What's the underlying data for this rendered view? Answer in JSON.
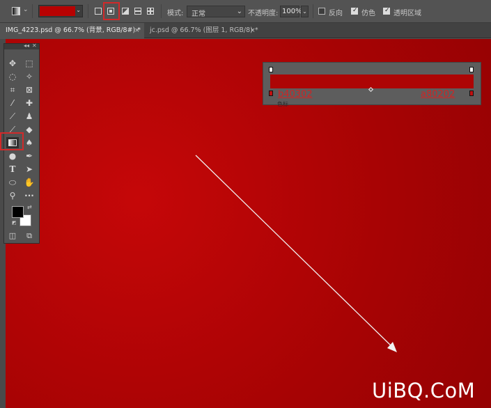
{
  "options_bar": {
    "gradient_color": "#b80202",
    "mode_label": "模式:",
    "mode_value": "正常",
    "opacity_label": "不透明度:",
    "opacity_value": "100%",
    "reverse_label": "反向",
    "dither_label": "仿色",
    "transparency_label": "透明区域",
    "reverse_checked": false,
    "dither_checked": true,
    "transparency_checked": true,
    "gradient_types": [
      "linear-gradient-icon",
      "radial-gradient-icon",
      "angle-gradient-icon",
      "reflected-gradient-icon",
      "diamond-gradient-icon"
    ],
    "selected_gradient_type": "radial-gradient-icon"
  },
  "tabs": [
    {
      "label": "IMG_4223.psd @ 66.7% (背景, RGB/8#) *",
      "close": "×",
      "active": true
    },
    {
      "label": "jc.psd @ 66.7% (图层 1, RGB/8) *",
      "close": "×",
      "active": false
    }
  ],
  "tools_panel": {
    "header_left": "◂◂",
    "header_right": "✕",
    "tools": [
      "move-icon",
      "marquee-icon",
      "lasso-icon",
      "magic-wand-icon",
      "crop-icon",
      "frame-icon",
      "eyedropper-icon",
      "healing-brush-icon",
      "brush-icon",
      "clone-stamp-icon",
      "history-brush-icon",
      "eraser-icon",
      "gradient-icon",
      "blur-icon",
      "dodge-icon",
      "pen-icon",
      "type-icon",
      "path-selection-icon",
      "ellipse-icon",
      "hand-rotate-icon",
      "zoom-icon",
      "more-tools-icon"
    ],
    "selected_tool": "gradient-icon",
    "foreground_color": "#000000",
    "background_color": "#ffffff"
  },
  "gradient_bar": {
    "left_stop_label": "b40302",
    "right_stop_label": "a80202",
    "color_label": "色标",
    "bar_color": "#ad0505"
  },
  "canvas": {
    "center_color": "#c50708",
    "edge_color": "#950203"
  },
  "watermark": "UiBQ.CoM"
}
